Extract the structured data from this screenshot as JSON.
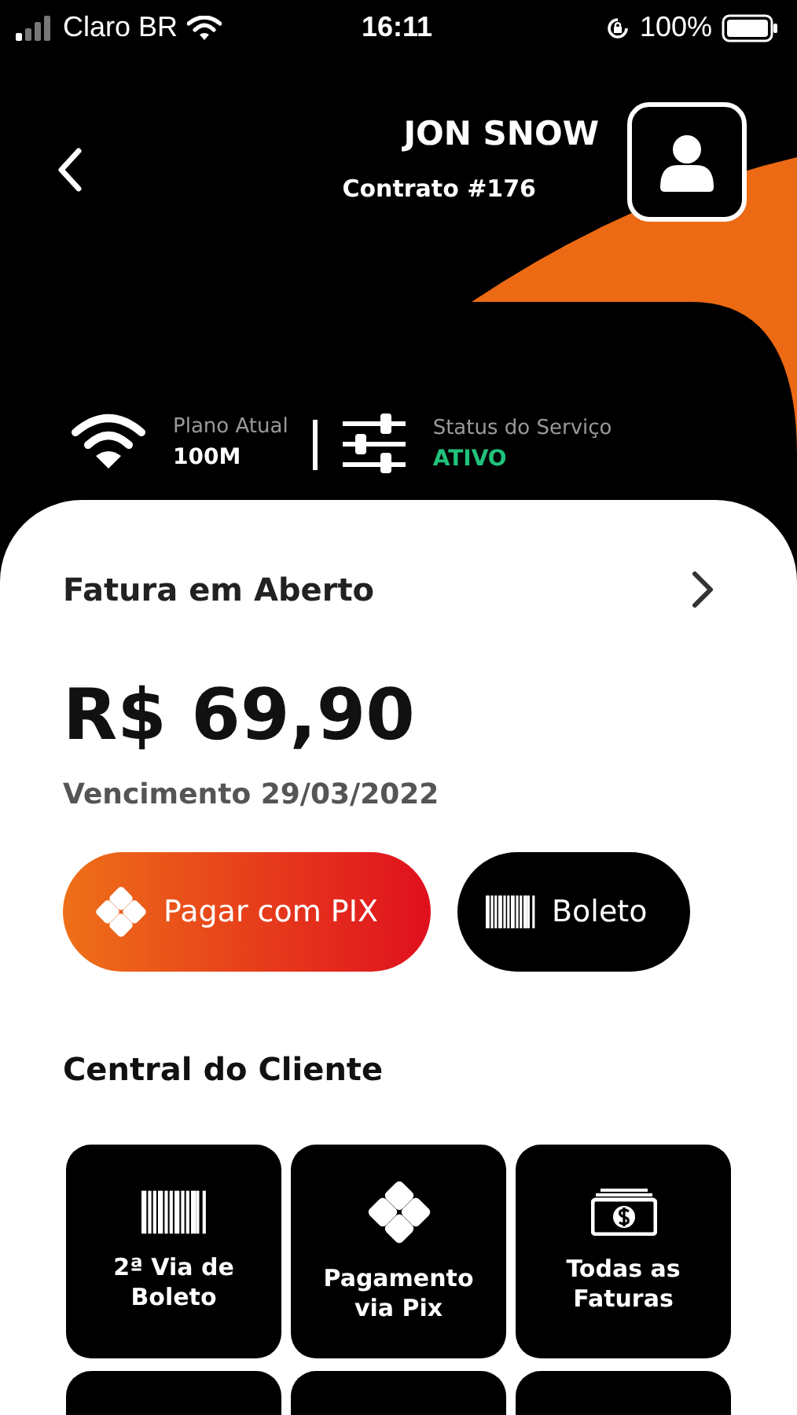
{
  "status_bar": {
    "carrier": "Claro BR",
    "time": "16:11",
    "battery": "100%"
  },
  "header": {
    "name": "JON SNOW",
    "contract": "Contrato #176"
  },
  "stats": [
    {
      "kind": "plan",
      "label": "Plano Atual",
      "value": "100M"
    },
    {
      "kind": "status",
      "label": "Status do Serviço",
      "value": "ATIVO"
    }
  ],
  "invoice": {
    "title": "Fatura em Aberto",
    "amount": "R$ 69,90",
    "due": "Vencimento 29/03/2022"
  },
  "actions": [
    {
      "kind": "pix",
      "label": "Pagar com PIX"
    },
    {
      "kind": "boleto",
      "label": "Boleto"
    }
  ],
  "section_title": "Central do Cliente",
  "tiles": [
    {
      "kind": "boleto",
      "label": "2ª Via de Boleto"
    },
    {
      "kind": "pix",
      "label": "Pagamento via Pix"
    },
    {
      "kind": "money",
      "label": "Todas as Faturas"
    },
    {
      "kind": "cut_off"
    },
    {
      "kind": "cut_off"
    },
    {
      "kind": "cut_off"
    }
  ]
}
